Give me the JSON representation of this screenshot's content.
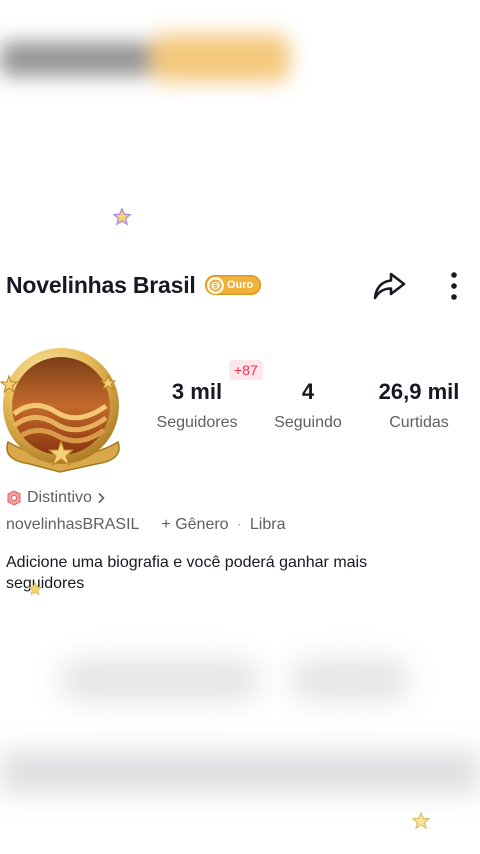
{
  "profile": {
    "name": "Novelinhas Brasil",
    "badge_label": "Ouro",
    "username": "novelinhasBRASIL",
    "gender_label": "+ Gênero",
    "separator": "·",
    "zodiac": "Libra",
    "distintivo_label": "Distintivo",
    "bio": "Adicione uma biografia e você poderá ganhar mais seguidores"
  },
  "stats": {
    "new_followers_badge": "+87",
    "followers": {
      "value": "3 mil",
      "label": "Seguidores"
    },
    "following": {
      "value": "4",
      "label": "Seguindo"
    },
    "likes": {
      "value": "26,9 mil",
      "label": "Curtidas"
    }
  },
  "icons": {
    "share": "share-arrow-icon",
    "more": "more-vertical-icon",
    "badge": "gold-medal-icon",
    "distintivo": "badge-shield-icon",
    "chevron": "chevron-right-icon",
    "sparkle": "sparkle-star-icon"
  },
  "colors": {
    "badge_gold": "#f0b23a",
    "accent_red": "#fe2c55",
    "text_primary": "#161823",
    "text_secondary": "#5c5f66"
  }
}
